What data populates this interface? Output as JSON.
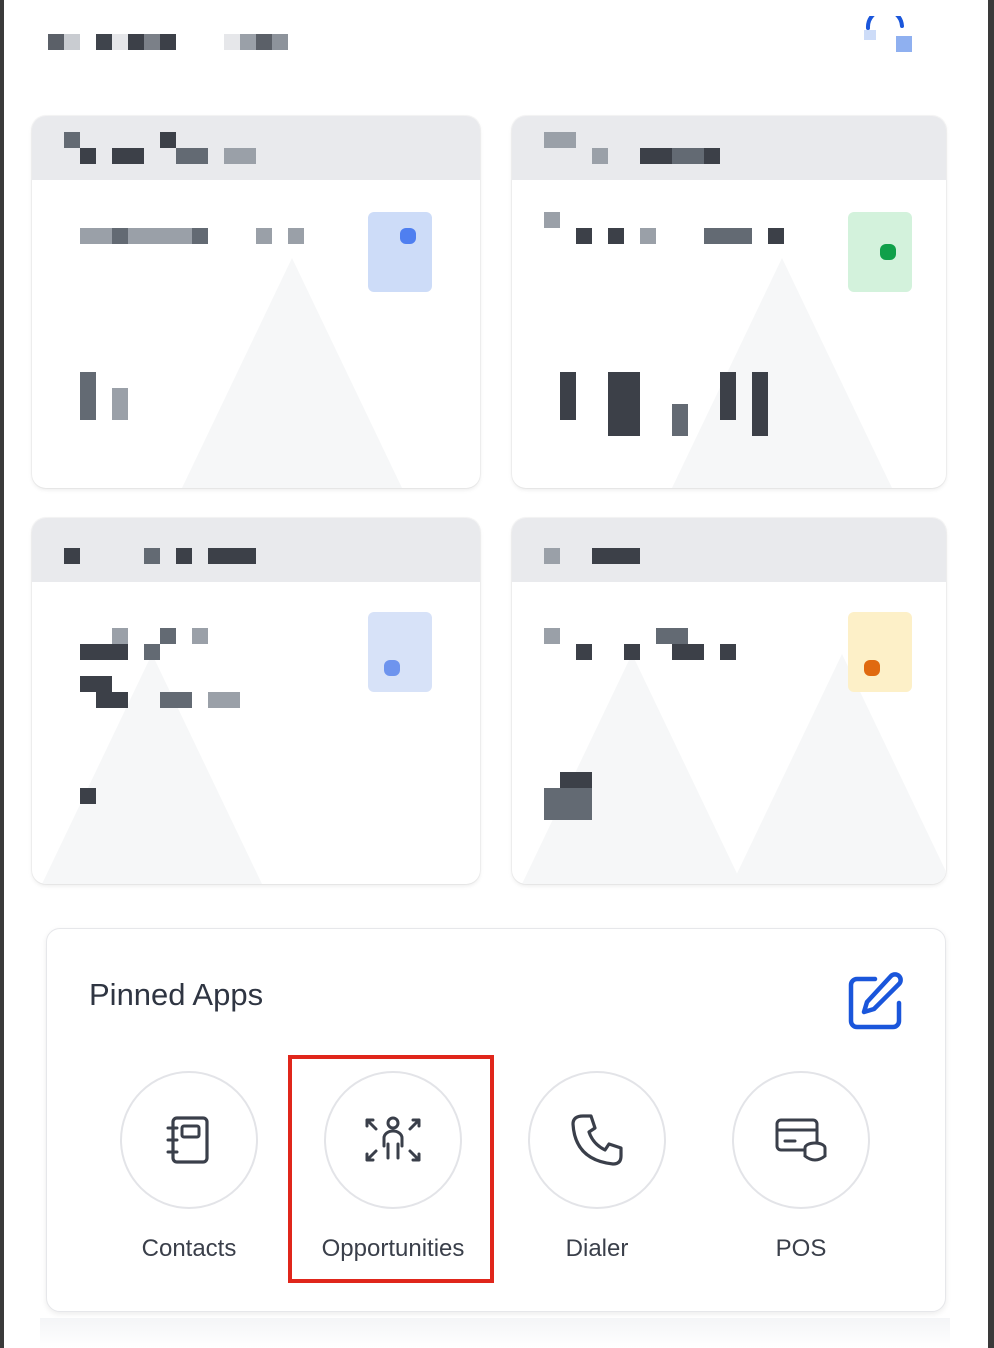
{
  "pinned_apps": {
    "title": "Pinned Apps",
    "edit_icon": "edit-icon",
    "items": [
      {
        "label": "Contacts",
        "icon": "contacts-book-icon"
      },
      {
        "label": "Opportunities",
        "icon": "opportunities-icon"
      },
      {
        "label": "Dialer",
        "icon": "phone-icon"
      },
      {
        "label": "POS",
        "icon": "pos-icon"
      }
    ]
  },
  "colors": {
    "accent": "#1a56db",
    "highlight": "#e0261b",
    "text": "#2f3542"
  }
}
